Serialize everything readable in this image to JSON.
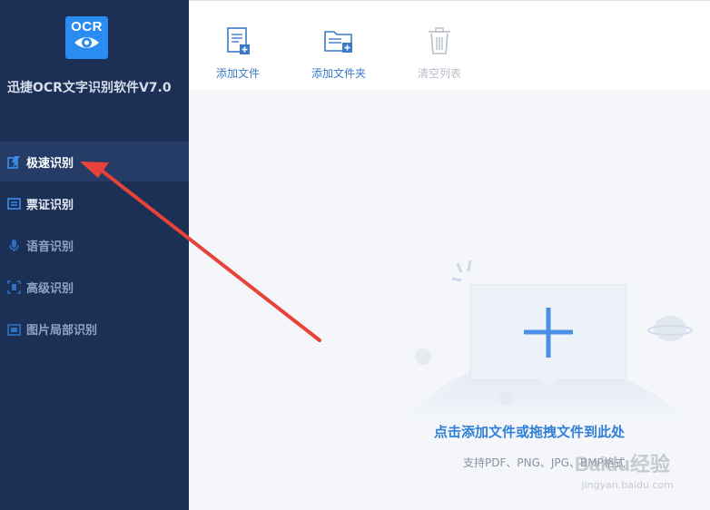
{
  "app": {
    "logo_text": "OCR",
    "title": "迅捷OCR文字识别软件V7.0"
  },
  "sidebar": {
    "items": [
      {
        "label": "极速识别",
        "icon": "fast-recognition-icon",
        "active": true
      },
      {
        "label": "票证识别",
        "icon": "ticket-recognition-icon",
        "active": false
      },
      {
        "label": "语音识别",
        "icon": "microphone-icon",
        "active": false
      },
      {
        "label": "高级识别",
        "icon": "scan-frame-icon",
        "active": false
      },
      {
        "label": "图片局部识别",
        "icon": "image-crop-icon",
        "active": false
      }
    ]
  },
  "toolbar": {
    "add_file_label": "添加文件",
    "add_folder_label": "添加文件夹",
    "clear_list_label": "清空列表"
  },
  "dropzone": {
    "main_text": "点击添加文件或拖拽文件到此处",
    "sub_text": "支持PDF、PNG、JPG、BMP格式"
  },
  "watermark": {
    "brand": "Baidu经验",
    "url": "jingyan.baidu.com"
  },
  "colors": {
    "sidebar_bg": "#1c2f55",
    "sidebar_active": "#243c66",
    "accent": "#2a8cf0",
    "annotation_arrow": "#e8433a"
  }
}
